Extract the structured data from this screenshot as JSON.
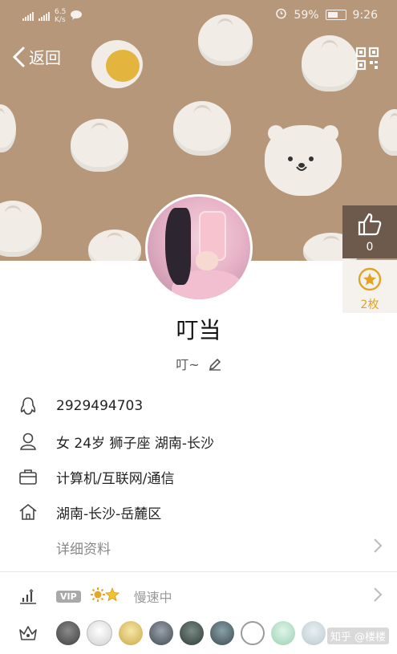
{
  "status_bar": {
    "speed_value": "6.5",
    "speed_unit": "K/s",
    "battery": "59%",
    "time": "9:26"
  },
  "topbar": {
    "back_label": "返回"
  },
  "side": {
    "like_count": "0",
    "badge_count": "2枚"
  },
  "profile": {
    "nickname": "叮当",
    "signature": "叮~"
  },
  "info": {
    "qq": "2929494703",
    "basic": "女  24岁  狮子座  湖南-长沙",
    "job": "计算机/互联网/通信",
    "home": "湖南-长沙-岳麓区",
    "detail": "详细资料"
  },
  "level": {
    "vip": "VIP",
    "speed": "慢速中"
  },
  "watermark": "知乎 @楼楼",
  "colors": {
    "cover": "#b6977a",
    "like_bg": "#6d5a4c",
    "badge_fg": "#e0a322"
  }
}
